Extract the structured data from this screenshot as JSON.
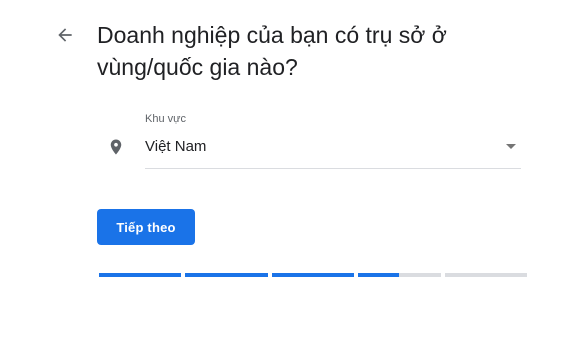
{
  "header": {
    "title": "Doanh nghiệp của bạn có trụ sở ở vùng/quốc gia nào?",
    "back_icon": "arrow-back-icon"
  },
  "form": {
    "region_label": "Khu vực",
    "region_value": "Việt Nam",
    "location_icon": "location-pin-icon",
    "dropdown_icon": "dropdown-arrow-icon"
  },
  "actions": {
    "next_label": "Tiếp theo"
  },
  "progress": {
    "steps": [
      1,
      1,
      1,
      0.5,
      0
    ],
    "accent_color": "#1a73e8",
    "track_color": "#dadce0"
  },
  "colors": {
    "primary": "#1a73e8",
    "text": "#202124",
    "secondary_text": "#5f6368"
  }
}
